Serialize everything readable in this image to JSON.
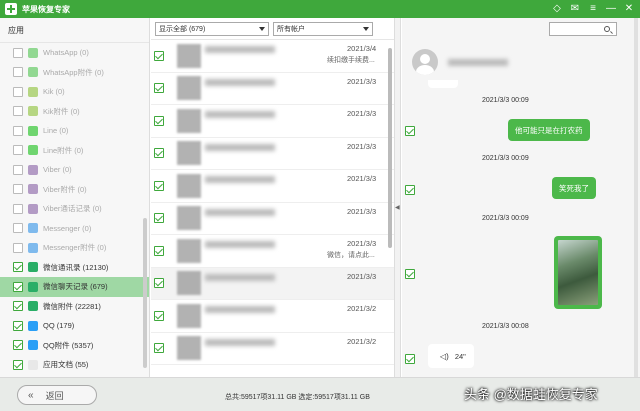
{
  "app": {
    "title": "苹果恢复专家"
  },
  "sidebar": {
    "header": "应用",
    "items": [
      {
        "label": "WhatsApp (0)",
        "icon": "whatsapp-icon",
        "color": "#3fbf3f",
        "checked": false,
        "disabled": true
      },
      {
        "label": "WhatsApp附件 (0)",
        "icon": "whatsapp-icon",
        "color": "#3fbf3f",
        "checked": false,
        "disabled": true
      },
      {
        "label": "Kik (0)",
        "icon": "kik-icon",
        "color": "#82bc23",
        "checked": false,
        "disabled": true
      },
      {
        "label": "Kik附件 (0)",
        "icon": "kik-icon",
        "color": "#82bc23",
        "checked": false,
        "disabled": true
      },
      {
        "label": "Line (0)",
        "icon": "line-icon",
        "color": "#00b900",
        "checked": false,
        "disabled": true
      },
      {
        "label": "Line附件 (0)",
        "icon": "line-icon",
        "color": "#00b900",
        "checked": false,
        "disabled": true
      },
      {
        "label": "Viber (0)",
        "icon": "viber-icon",
        "color": "#7b519d",
        "checked": false,
        "disabled": true
      },
      {
        "label": "Viber附件 (0)",
        "icon": "viber-icon",
        "color": "#7b519d",
        "checked": false,
        "disabled": true
      },
      {
        "label": "Viber通话记录 (0)",
        "icon": "viber-icon",
        "color": "#7b519d",
        "checked": false,
        "disabled": true
      },
      {
        "label": "Messenger (0)",
        "icon": "messenger-icon",
        "color": "#1e88e5",
        "checked": false,
        "disabled": true
      },
      {
        "label": "Messenger附件 (0)",
        "icon": "messenger-icon",
        "color": "#1e88e5",
        "checked": false,
        "disabled": true
      },
      {
        "label": "微信通讯录 (12130)",
        "icon": "wechat-icon",
        "color": "#2aae67",
        "checked": true,
        "disabled": false
      },
      {
        "label": "微信聊天记录 (679)",
        "icon": "wechat-icon",
        "color": "#2aae67",
        "checked": true,
        "disabled": false,
        "active": true
      },
      {
        "label": "微信附件 (22281)",
        "icon": "wechat-icon",
        "color": "#2aae67",
        "checked": true,
        "disabled": false
      },
      {
        "label": "QQ (179)",
        "icon": "qq-icon",
        "color": "#2a9ff6",
        "checked": true,
        "disabled": false
      },
      {
        "label": "QQ附件 (5357)",
        "icon": "qq-icon",
        "color": "#2a9ff6",
        "checked": true,
        "disabled": false
      },
      {
        "label": "应用文档 (55)",
        "icon": "document-icon",
        "color": "#e8e8e8",
        "checked": true,
        "disabled": false
      }
    ]
  },
  "filters": {
    "show": "显示全部 (679)",
    "account": "所有帐户"
  },
  "list": {
    "rows": [
      {
        "date": "2021/3/4",
        "snippet": "续扣缴手续费...",
        "selected": false
      },
      {
        "date": "2021/3/3",
        "snippet": "",
        "selected": false
      },
      {
        "date": "2021/3/3",
        "snippet": "",
        "selected": false
      },
      {
        "date": "2021/3/3",
        "snippet": "",
        "selected": false
      },
      {
        "date": "2021/3/3",
        "snippet": "",
        "selected": false
      },
      {
        "date": "2021/3/3",
        "snippet": "",
        "selected": false
      },
      {
        "date": "2021/3/3",
        "snippet": "微信，请点此...",
        "selected": false
      },
      {
        "date": "2021/3/3",
        "snippet": "",
        "selected": true
      },
      {
        "date": "2021/3/2",
        "snippet": "",
        "selected": false
      },
      {
        "date": "2021/3/2",
        "snippet": "",
        "selected": false
      }
    ]
  },
  "chat": {
    "timestamps": [
      "2021/3/3 00:09",
      "2021/3/3 00:09",
      "2021/3/3 00:09",
      "2021/3/3 00:08"
    ],
    "messages": [
      "他可能只是在打农药",
      "笑死我了"
    ],
    "voice_duration": "24\""
  },
  "status": {
    "back_label": "返回",
    "summary": "总共:59517项31.11 GB 选定:59517项31.11 GB"
  },
  "watermark": "头条 @数据蛙恢复专家"
}
